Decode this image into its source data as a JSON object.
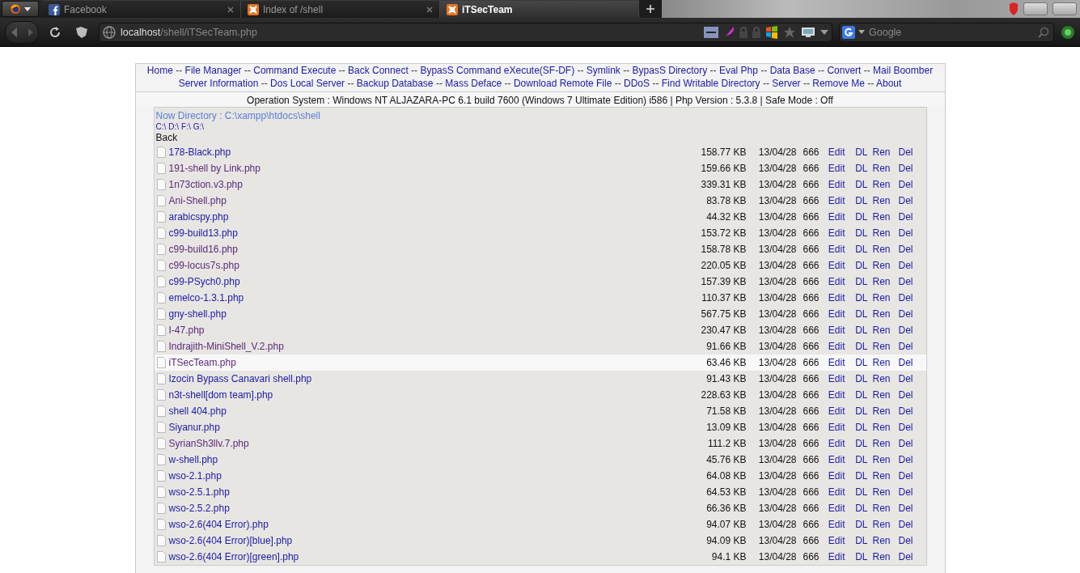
{
  "browser": {
    "tabs": [
      {
        "label": "Facebook",
        "selected": false
      },
      {
        "label": "Index of /shell",
        "selected": false
      },
      {
        "label": "iTSecTeam",
        "selected": true
      }
    ],
    "url_host": "localhost",
    "url_path": "/shell/iTSecTeam.php",
    "search": {
      "placeholder": "Google"
    }
  },
  "page": {
    "nav": [
      [
        {
          "label": "Home",
          "after": "--"
        },
        {
          "label": "File Manager",
          "after": "--"
        },
        {
          "label": "Command Execute",
          "after": "--"
        },
        {
          "label": "Back Connect",
          "after": "--"
        },
        {
          "label": "BypasS Command eXecute(SF-DF)",
          "after": "--"
        },
        {
          "label": "Symlink",
          "after": "--"
        },
        {
          "label": "BypasS Directory",
          "after": "--"
        },
        {
          "label": "Eval Php",
          "after": "--"
        },
        {
          "label": "Data Base",
          "after": "--"
        },
        {
          "label": "Convert",
          "after": "--"
        },
        {
          "label": "Mail Boomber"
        }
      ],
      [
        {
          "label": "Server Information",
          "after": "--"
        },
        {
          "label": "Dos Local Server",
          "after": "--"
        },
        {
          "label": "Backup Database",
          "after": "--"
        },
        {
          "label": "Mass Deface",
          "after": "--"
        },
        {
          "label": "Download Remote File",
          "after": "--"
        },
        {
          "label": "DDoS",
          "after": "--"
        },
        {
          "label": "Find Writable Directory",
          "after": "--"
        },
        {
          "label": "Server",
          "after": "--"
        },
        {
          "label": "Remove Me",
          "after": "--"
        },
        {
          "label": "About"
        }
      ]
    ],
    "system_info": "Operation System : Windows NT ALJAZARA-PC 6.1 build 7600 (Windows 7 Ultimate Edition) i586 | Php Version : 5.3.8 | Safe Mode : Off",
    "directory": "Now Directory : C:\\xampp\\htdocs\\shell",
    "drives": [
      "C:\\",
      "D:\\",
      "F:\\",
      "G:\\"
    ],
    "back": "Back",
    "files": [
      {
        "name": "178-Black.php",
        "size": "158.77 KB",
        "date": "13/04/28",
        "perms": "666",
        "visited": false,
        "highlighted": false,
        "actions": [
          "Edit",
          "DL",
          "Ren",
          "Del"
        ]
      },
      {
        "name": "191-shell by Link.php",
        "size": "159.66 KB",
        "date": "13/04/28",
        "perms": "666",
        "visited": true,
        "highlighted": false,
        "actions": [
          "Edit",
          "DL",
          "Ren",
          "Del"
        ]
      },
      {
        "name": "1n73ction.v3.php",
        "size": "339.31 KB",
        "date": "13/04/28",
        "perms": "666",
        "visited": true,
        "highlighted": false,
        "actions": [
          "Edit",
          "DL",
          "Ren",
          "Del"
        ]
      },
      {
        "name": "Ani-Shell.php",
        "size": "83.78 KB",
        "date": "13/04/28",
        "perms": "666",
        "visited": true,
        "highlighted": false,
        "actions": [
          "Edit",
          "DL",
          "Ren",
          "Del"
        ]
      },
      {
        "name": "arabicspy.php",
        "size": "44.32 KB",
        "date": "13/04/28",
        "perms": "666",
        "visited": false,
        "highlighted": false,
        "actions": [
          "Edit",
          "DL",
          "Ren",
          "Del"
        ]
      },
      {
        "name": "c99-build13.php",
        "size": "153.72 KB",
        "date": "13/04/28",
        "perms": "666",
        "visited": false,
        "highlighted": false,
        "actions": [
          "Edit",
          "DL",
          "Ren",
          "Del"
        ]
      },
      {
        "name": "c99-build16.php",
        "size": "158.78 KB",
        "date": "13/04/28",
        "perms": "666",
        "visited": true,
        "highlighted": false,
        "actions": [
          "Edit",
          "DL",
          "Ren",
          "Del"
        ]
      },
      {
        "name": "c99-locus7s.php",
        "size": "220.05 KB",
        "date": "13/04/28",
        "perms": "666",
        "visited": true,
        "highlighted": false,
        "actions": [
          "Edit",
          "DL",
          "Ren",
          "Del"
        ]
      },
      {
        "name": "c99-PSych0.php",
        "size": "157.39 KB",
        "date": "13/04/28",
        "perms": "666",
        "visited": false,
        "highlighted": false,
        "actions": [
          "Edit",
          "DL",
          "Ren",
          "Del"
        ]
      },
      {
        "name": "emelco-1.3.1.php",
        "size": "110.37 KB",
        "date": "13/04/28",
        "perms": "666",
        "visited": false,
        "highlighted": false,
        "actions": [
          "Edit",
          "DL",
          "Ren",
          "Del"
        ]
      },
      {
        "name": "gny-shell.php",
        "size": "567.75 KB",
        "date": "13/04/28",
        "perms": "666",
        "visited": false,
        "highlighted": false,
        "actions": [
          "Edit",
          "DL",
          "Ren",
          "Del"
        ]
      },
      {
        "name": "I-47.php",
        "size": "230.47 KB",
        "date": "13/04/28",
        "perms": "666",
        "visited": true,
        "highlighted": false,
        "actions": [
          "Edit",
          "DL",
          "Ren",
          "Del"
        ]
      },
      {
        "name": "Indrajith-MiniShell_V.2.php",
        "size": "91.66 KB",
        "date": "13/04/28",
        "perms": "666",
        "visited": true,
        "highlighted": false,
        "actions": [
          "Edit",
          "DL",
          "Ren",
          "Del"
        ]
      },
      {
        "name": "iTSecTeam.php",
        "size": "63.46 KB",
        "date": "13/04/28",
        "perms": "666",
        "visited": true,
        "highlighted": true,
        "actions": [
          "Edit",
          "DL",
          "Ren",
          "Del"
        ]
      },
      {
        "name": "Izocin Bypass Canavari shell.php",
        "size": "91.43 KB",
        "date": "13/04/28",
        "perms": "666",
        "visited": false,
        "highlighted": false,
        "actions": [
          "Edit",
          "DL",
          "Ren",
          "Del"
        ]
      },
      {
        "name": "n3t-shell[dom team].php",
        "size": "228.63 KB",
        "date": "13/04/28",
        "perms": "666",
        "visited": false,
        "highlighted": false,
        "actions": [
          "Edit",
          "DL",
          "Ren",
          "Del"
        ]
      },
      {
        "name": "shell 404.php",
        "size": "71.58 KB",
        "date": "13/04/28",
        "perms": "666",
        "visited": false,
        "highlighted": false,
        "actions": [
          "Edit",
          "DL",
          "Ren",
          "Del"
        ]
      },
      {
        "name": "Siyanur.php",
        "size": "13.09 KB",
        "date": "13/04/28",
        "perms": "666",
        "visited": false,
        "highlighted": false,
        "actions": [
          "Edit",
          "DL",
          "Ren",
          "Del"
        ]
      },
      {
        "name": "SyrianSh3llv.7.php",
        "size": "111.2 KB",
        "date": "13/04/28",
        "perms": "666",
        "visited": true,
        "highlighted": false,
        "actions": [
          "Edit",
          "DL",
          "Ren",
          "Del"
        ]
      },
      {
        "name": "w-shell.php",
        "size": "45.76 KB",
        "date": "13/04/28",
        "perms": "666",
        "visited": false,
        "highlighted": false,
        "actions": [
          "Edit",
          "DL",
          "Ren",
          "Del"
        ]
      },
      {
        "name": "wso-2.1.php",
        "size": "64.08 KB",
        "date": "13/04/28",
        "perms": "666",
        "visited": false,
        "highlighted": false,
        "actions": [
          "Edit",
          "DL",
          "Ren",
          "Del"
        ]
      },
      {
        "name": "wso-2.5.1.php",
        "size": "64.53 KB",
        "date": "13/04/28",
        "perms": "666",
        "visited": false,
        "highlighted": false,
        "actions": [
          "Edit",
          "DL",
          "Ren",
          "Del"
        ]
      },
      {
        "name": "wso-2.5.2.php",
        "size": "66.36 KB",
        "date": "13/04/28",
        "perms": "666",
        "visited": false,
        "highlighted": false,
        "actions": [
          "Edit",
          "DL",
          "Ren",
          "Del"
        ]
      },
      {
        "name": "wso-2.6(404 Error).php",
        "size": "94.07 KB",
        "date": "13/04/28",
        "perms": "666",
        "visited": false,
        "highlighted": false,
        "actions": [
          "Edit",
          "DL",
          "Ren",
          "Del"
        ]
      },
      {
        "name": "wso-2.6(404 Error)[blue].php",
        "size": "94.09 KB",
        "date": "13/04/28",
        "perms": "666",
        "visited": false,
        "highlighted": false,
        "actions": [
          "Edit",
          "DL",
          "Ren",
          "Del"
        ]
      },
      {
        "name": "wso-2.6(404 Error)[green].php",
        "size": "94.1 KB",
        "date": "13/04/28",
        "perms": "666",
        "visited": false,
        "highlighted": false,
        "actions": [
          "Edit",
          "DL",
          "Ren",
          "Del"
        ]
      }
    ]
  }
}
